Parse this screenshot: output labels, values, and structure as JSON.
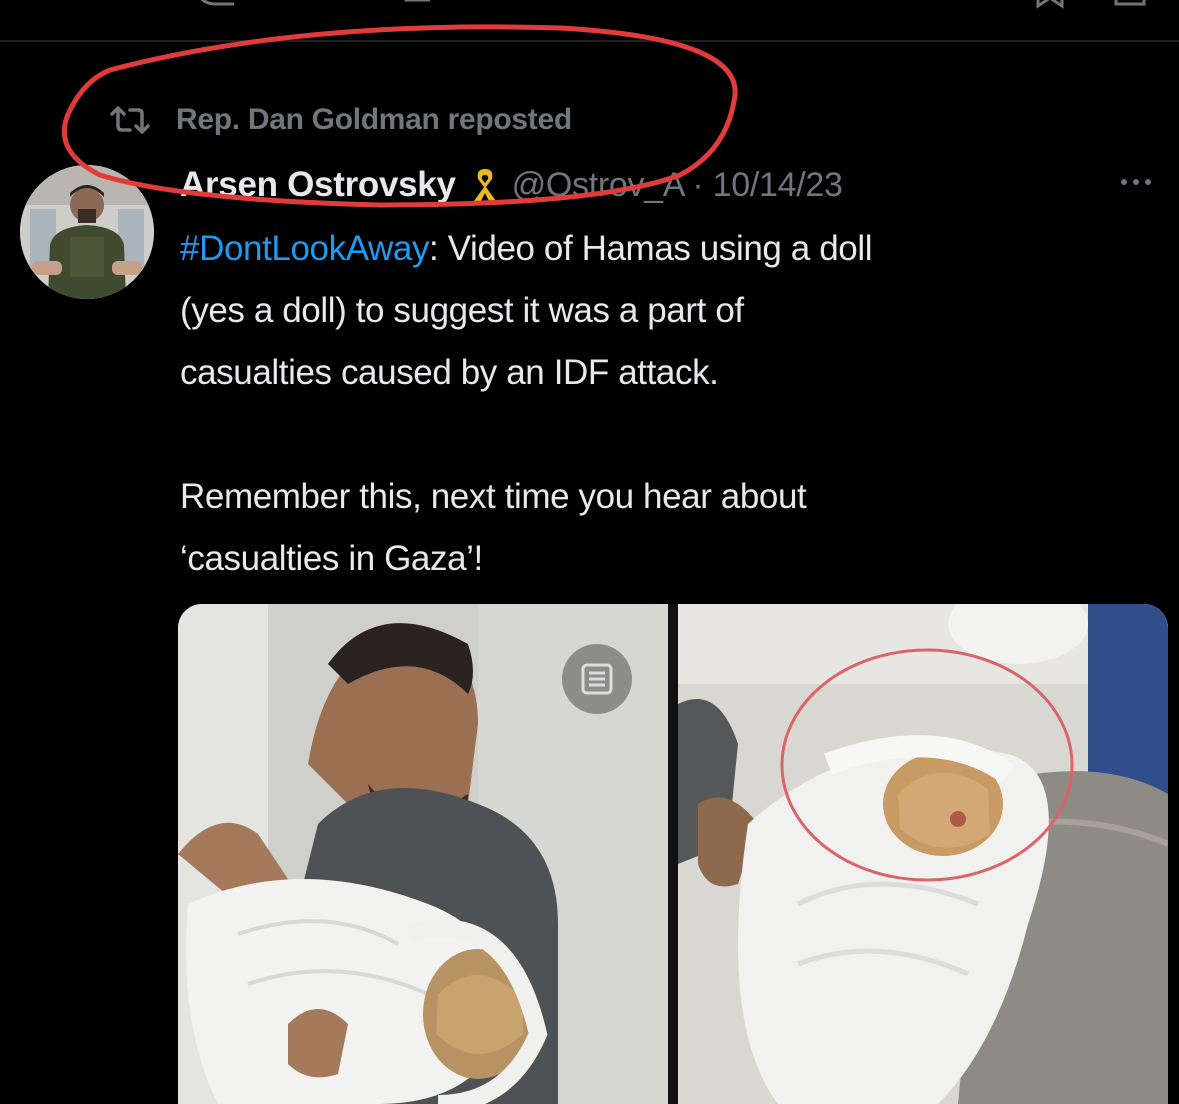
{
  "repost": {
    "icon": "repost-icon",
    "text": "Rep. Dan Goldman reposted"
  },
  "tweet": {
    "display_name": "Arsen Ostrovsky",
    "badge_icon": "yellow-ribbon-icon",
    "handle_and_date": "@Ostrov_A · 10/14/23",
    "hashtag": "#DontLookAway",
    "line1_rest": ": Video of Hamas using a doll",
    "line2": "(yes a doll) to suggest it was a part of",
    "line3": "casualties caused by an IDF attack.",
    "line4": "Remember this, next time you hear about",
    "line5": "‘casualties in Gaza’!"
  },
  "colors": {
    "background": "#000000",
    "text": "#e7e9ea",
    "secondary_text": "#71767b",
    "hashtag": "#1d9bf0",
    "annotation": "#e23b3b"
  }
}
